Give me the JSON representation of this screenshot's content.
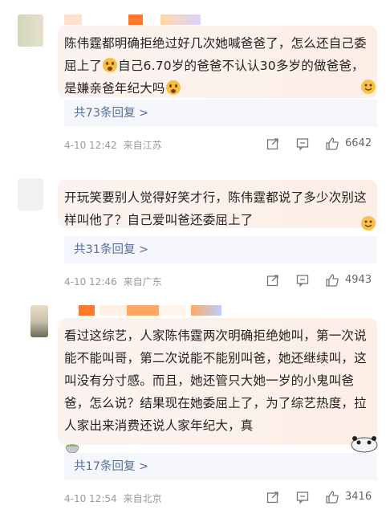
{
  "comments": [
    {
      "text_parts": [
        "陈伟霆都明确拒绝过好几次她喊爸爸了，怎么还自己委屈上了",
        "自己6.70岁的爸爸不认认30多岁的做爸爸，是嫌亲爸年纪大吗"
      ],
      "replies": "共73条回复 >",
      "time": "4-10 12:42",
      "location": "来自江苏",
      "likes": "6642"
    },
    {
      "text_parts": [
        "开玩笑要别人觉得好笑才行，陈伟霆都说了多少次别这样叫他了？自己爱叫爸还委屈上了"
      ],
      "replies": "共31条回复 >",
      "time": "4-10 12:46",
      "location": "来自广东",
      "likes": "4943"
    },
    {
      "text_parts": [
        "看过这综艺，人家陈伟霆两次明确拒绝她叫，第一次说能不能叫哥，第二次说能不能别叫爸，她还继续叫，这叫没有分寸感。而且，她还管只大她一岁的小鬼叫爸爸，怎么说？结果现在她委屈上了，为了综艺热度，拉人家出来消费还说人家年纪大，真"
      ],
      "replies": "共17条回复 >",
      "time": "4-10 12:54",
      "location": "来自北京",
      "likes": "3416"
    }
  ],
  "colors": {
    "link": "#596e9a",
    "bubble": "#fdeee6",
    "reply_bg": "#f4f6fb",
    "meta": "#999999"
  },
  "icons": [
    "share-icon",
    "comment-icon",
    "like-icon",
    "smile-emoji-icon",
    "teacup-emoji-icon"
  ]
}
